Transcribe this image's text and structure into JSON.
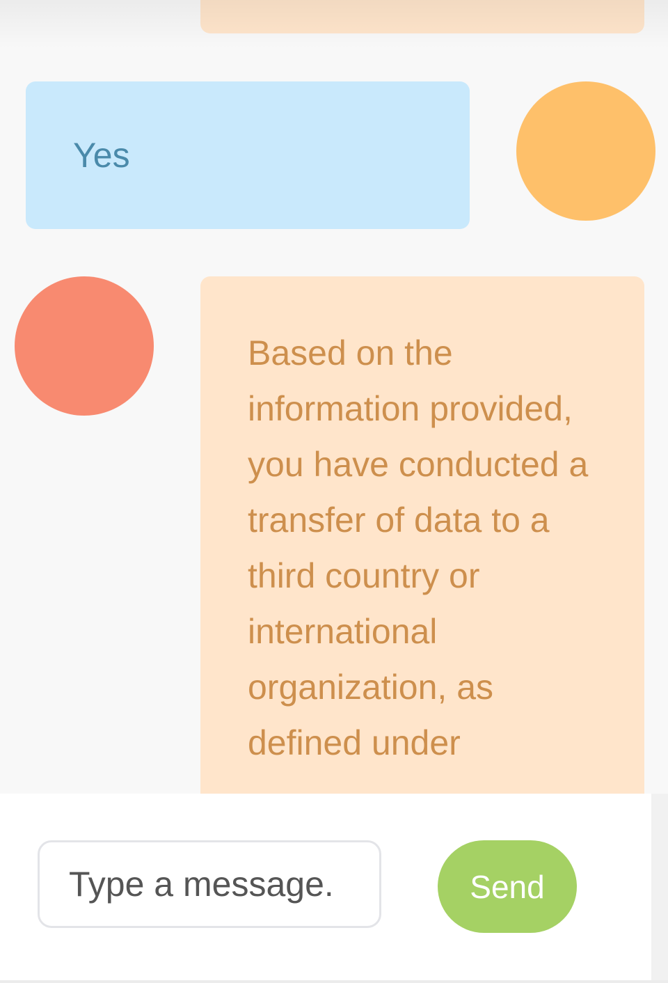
{
  "conversation": {
    "messages": [
      {
        "sender": "bot",
        "text": ""
      },
      {
        "sender": "user",
        "text": "Yes"
      },
      {
        "sender": "bot",
        "text": "Based on the information provided, you have conducted a transfer of data to a third country or international organization, as defined under"
      }
    ]
  },
  "composer": {
    "placeholder": "Type a message.",
    "value": "",
    "send_label": "Send"
  },
  "colors": {
    "background": "#f8f8f8",
    "user_bubble": "#c9e9fc",
    "user_text": "#4a8aaa",
    "bot_bubble": "#ffe5cb",
    "bot_text": "#cd8f4d",
    "user_avatar": "#fec06a",
    "bot_avatar": "#f88a70",
    "send_button": "#a5d164"
  }
}
